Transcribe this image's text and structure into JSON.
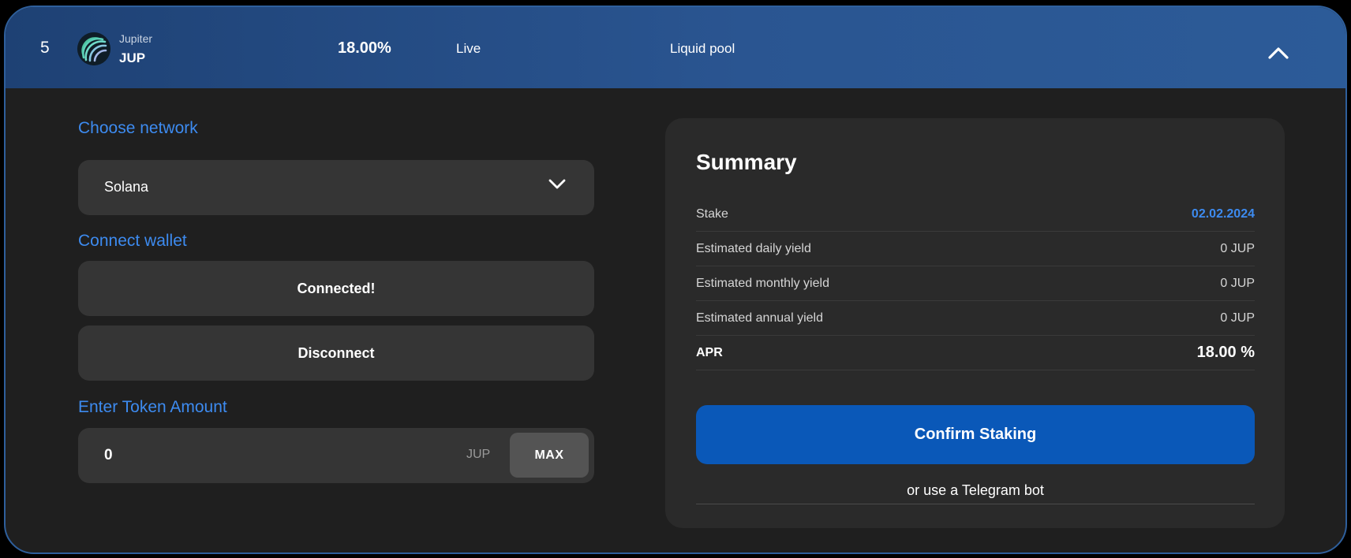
{
  "row": {
    "rank": "5",
    "token_subtitle": "Jupiter",
    "token_symbol": "JUP",
    "apr": "18.00%",
    "status": "Live",
    "pool_type": "Liquid pool",
    "logo_icon": "jupiter-logo-icon",
    "collapse_icon": "chevron-up-icon"
  },
  "network": {
    "title": "Choose network",
    "selected": "Solana",
    "chevron_icon": "chevron-down-icon"
  },
  "wallet": {
    "title": "Connect wallet",
    "status_label": "Connected!",
    "disconnect_label": "Disconnect"
  },
  "amount": {
    "title": "Enter Token Amount",
    "value": "0",
    "unit": "JUP",
    "max_label": "MAX"
  },
  "summary": {
    "title": "Summary",
    "rows": [
      {
        "label": "Stake",
        "value": "02.02.2024"
      },
      {
        "label": "Estimated daily yield",
        "value": "0 JUP"
      },
      {
        "label": "Estimated monthly yield",
        "value": "0 JUP"
      },
      {
        "label": "Estimated annual yield",
        "value": "0 JUP"
      },
      {
        "label": "APR",
        "value": "18.00 %"
      }
    ],
    "confirm_label": "Confirm Staking",
    "telegram_label": "or use a Telegram bot"
  },
  "colors": {
    "accent": "#3d8bf0",
    "primary_button": "#0a58b8",
    "header_start": "#1e4174",
    "header_end": "#2c5b98",
    "panel": "#2a2a2a",
    "field": "#353535"
  }
}
